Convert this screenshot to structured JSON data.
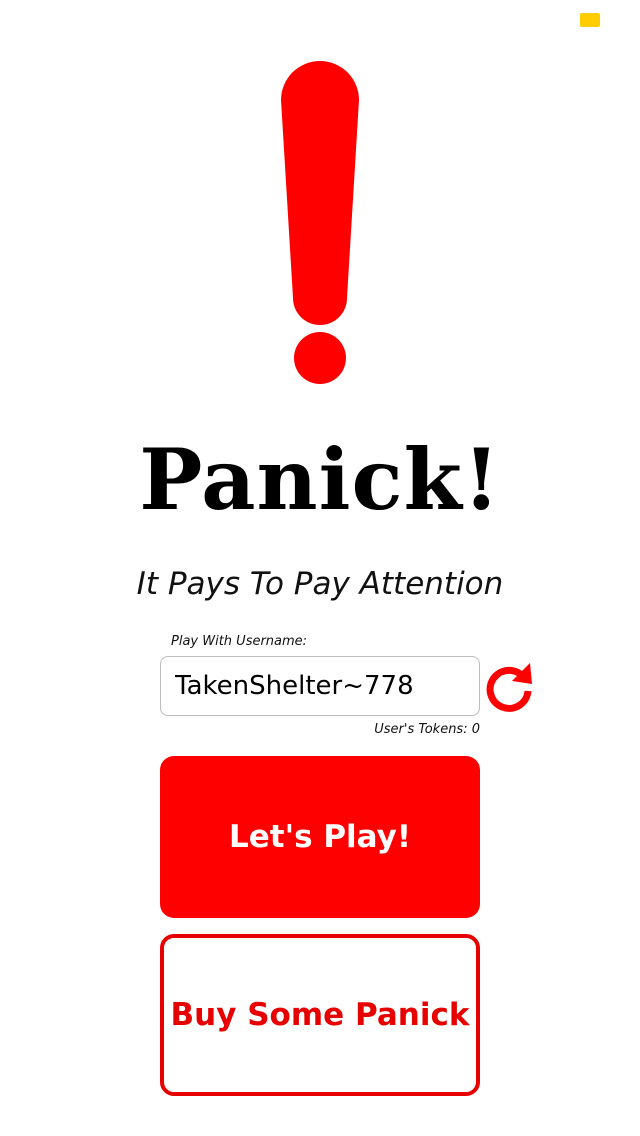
{
  "status": {
    "indicator_color": "#ffcc00"
  },
  "hero": {
    "icon": "exclamation-icon",
    "icon_color": "#ff0000"
  },
  "app": {
    "title": "Panick!",
    "tagline": "It Pays To Pay Attention"
  },
  "username": {
    "label": "Play With Username:",
    "value": "TakenShelter~778",
    "refresh_icon": "refresh-icon"
  },
  "tokens": {
    "text": "User's Tokens: 0"
  },
  "actions": {
    "play_label": "Let's Play!",
    "buy_label": "Buy Some Panick"
  },
  "colors": {
    "accent": "#ff0000",
    "outline": "#e60000"
  }
}
